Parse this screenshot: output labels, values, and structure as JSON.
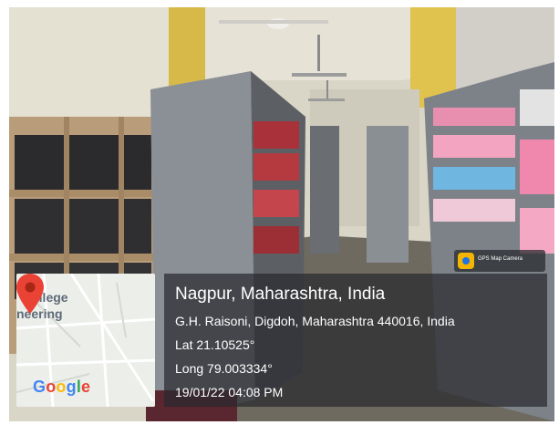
{
  "map_card": {
    "label_top": "College",
    "label_bottom": "neering",
    "brand": [
      "G",
      "o",
      "o",
      "g",
      "l",
      "e"
    ]
  },
  "location_box": {
    "city_line": "Nagpur, Maharashtra, India",
    "address_line": "G.H. Raisoni, Digdoh, Maharashtra 440016, India",
    "lat_line": "Lat 21.10525°",
    "long_line": "Long 79.003334°",
    "datetime_line": "19/01/22 04:08 PM"
  },
  "app_badge": {
    "label": "GPS Map Camera"
  },
  "colors": {
    "overlay": "#2b2d30",
    "pin_red": "#ea4335",
    "shelf_grey": "#9aa0a6"
  }
}
